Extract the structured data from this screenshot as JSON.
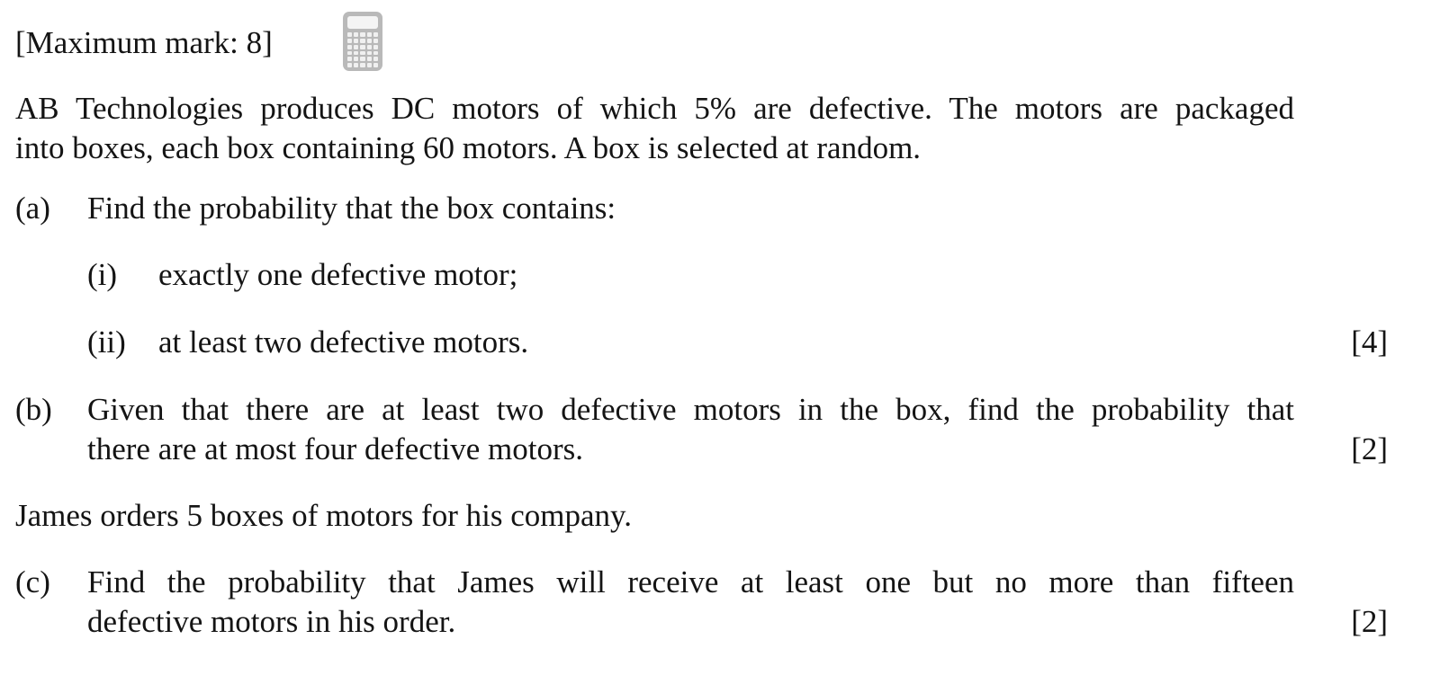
{
  "header": {
    "max_mark": "[Maximum mark: 8]",
    "calculator_icon": "calculator-icon"
  },
  "intro": {
    "line1": "AB Technologies produces DC motors of which 5% are defective. The motors are packaged",
    "line2": "into boxes, each box containing 60 motors. A box is selected at random."
  },
  "part_a": {
    "label": "(a)",
    "text": "Find the probability that the box contains:",
    "sub_i": {
      "label": "(i)",
      "text": "exactly one defective motor;"
    },
    "sub_ii": {
      "label": "(ii)",
      "text": "at least two defective motors."
    },
    "marks": "[4]"
  },
  "part_b": {
    "label": "(b)",
    "line1": "Given that there are at least two defective motors in the box, find the probability that",
    "line2": "there are at most four defective motors.",
    "marks": "[2]"
  },
  "middle": {
    "text": "James orders 5 boxes of motors for his company."
  },
  "part_c": {
    "label": "(c)",
    "line1": "Find the probability that James will receive at least one but no more than fifteen",
    "line2": "defective motors in his order.",
    "marks": "[2]"
  }
}
